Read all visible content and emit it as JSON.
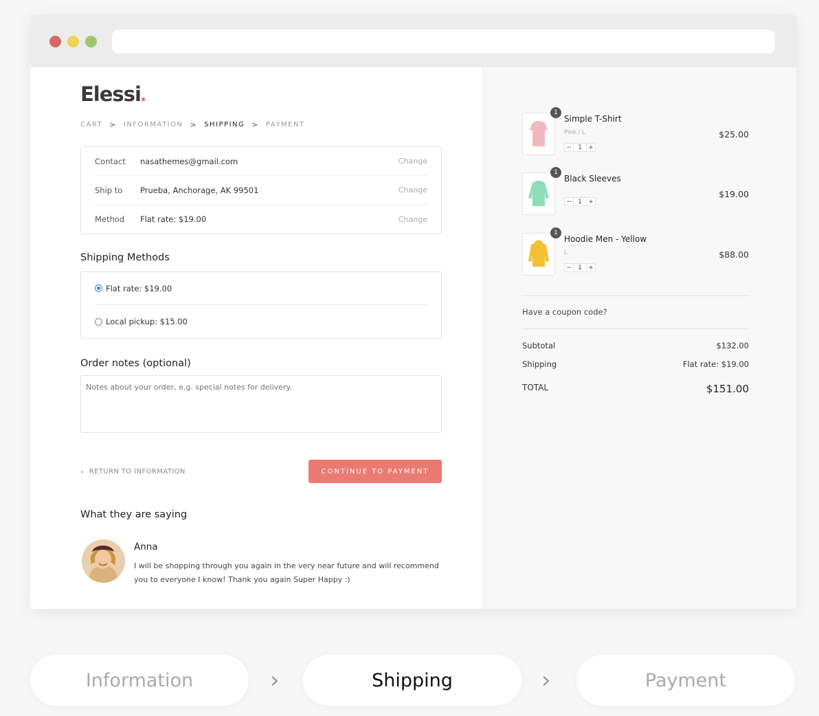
{
  "logo": {
    "text": "Elessi"
  },
  "breadcrumb": {
    "items": [
      {
        "label": "CART"
      },
      {
        "label": "INFORMATION"
      },
      {
        "label": "SHIPPING"
      },
      {
        "label": "PAYMENT"
      }
    ],
    "separator": ">"
  },
  "review": {
    "contact": {
      "label": "Contact",
      "value": "nasathemes@gmail.com",
      "change": "Change"
    },
    "ship_to": {
      "label": "Ship to",
      "value": "Prueba, Anchorage, AK 99501",
      "change": "Change"
    },
    "method": {
      "label": "Method",
      "value": "Flat rate: $19.00",
      "change": "Change"
    }
  },
  "shipping_methods": {
    "title": "Shipping Methods",
    "options": [
      {
        "label": "Flat rate: $19.00",
        "checked": true
      },
      {
        "label": "Local pickup: $15.00",
        "checked": false
      }
    ]
  },
  "order_notes": {
    "title": "Order notes (optional)",
    "placeholder": "Notes about your order, e.g. special notes for delivery."
  },
  "actions": {
    "return_label": "RETURN TO INFORMATION",
    "continue_label": "CONTINUE TO PAYMENT"
  },
  "testimonials": {
    "title": "What they are saying",
    "name": "Anna",
    "text": "I will be shopping through you again in the very near future and will recommend you to everyone I know! Thank you again Super Happy :)"
  },
  "cart": {
    "items": [
      {
        "name": "Simple T-Shirt",
        "variant": "Pink / L",
        "qty": "1",
        "price": "$25.00",
        "color": "#f2b8c0"
      },
      {
        "name": "Black Sleeves",
        "variant": "",
        "qty": "1",
        "price": "$19.00",
        "color": "#8fdcb8"
      },
      {
        "name": "Hoodie Men - Yellow",
        "variant": "L",
        "qty": "1",
        "price": "$88.00",
        "color": "#f2c033"
      }
    ],
    "coupon_text": "Have a coupon code?",
    "subtotal_label": "Subtotal",
    "subtotal_value": "$132.00",
    "shipping_label": "Shipping",
    "shipping_value": "Flat rate: $19.00",
    "total_label": "TOTAL",
    "total_value": "$151.00"
  },
  "steps": {
    "information": "Information",
    "shipping": "Shipping",
    "payment": "Payment"
  },
  "colors": {
    "accent": "#eb7a72",
    "radio": "#3b82d6"
  }
}
